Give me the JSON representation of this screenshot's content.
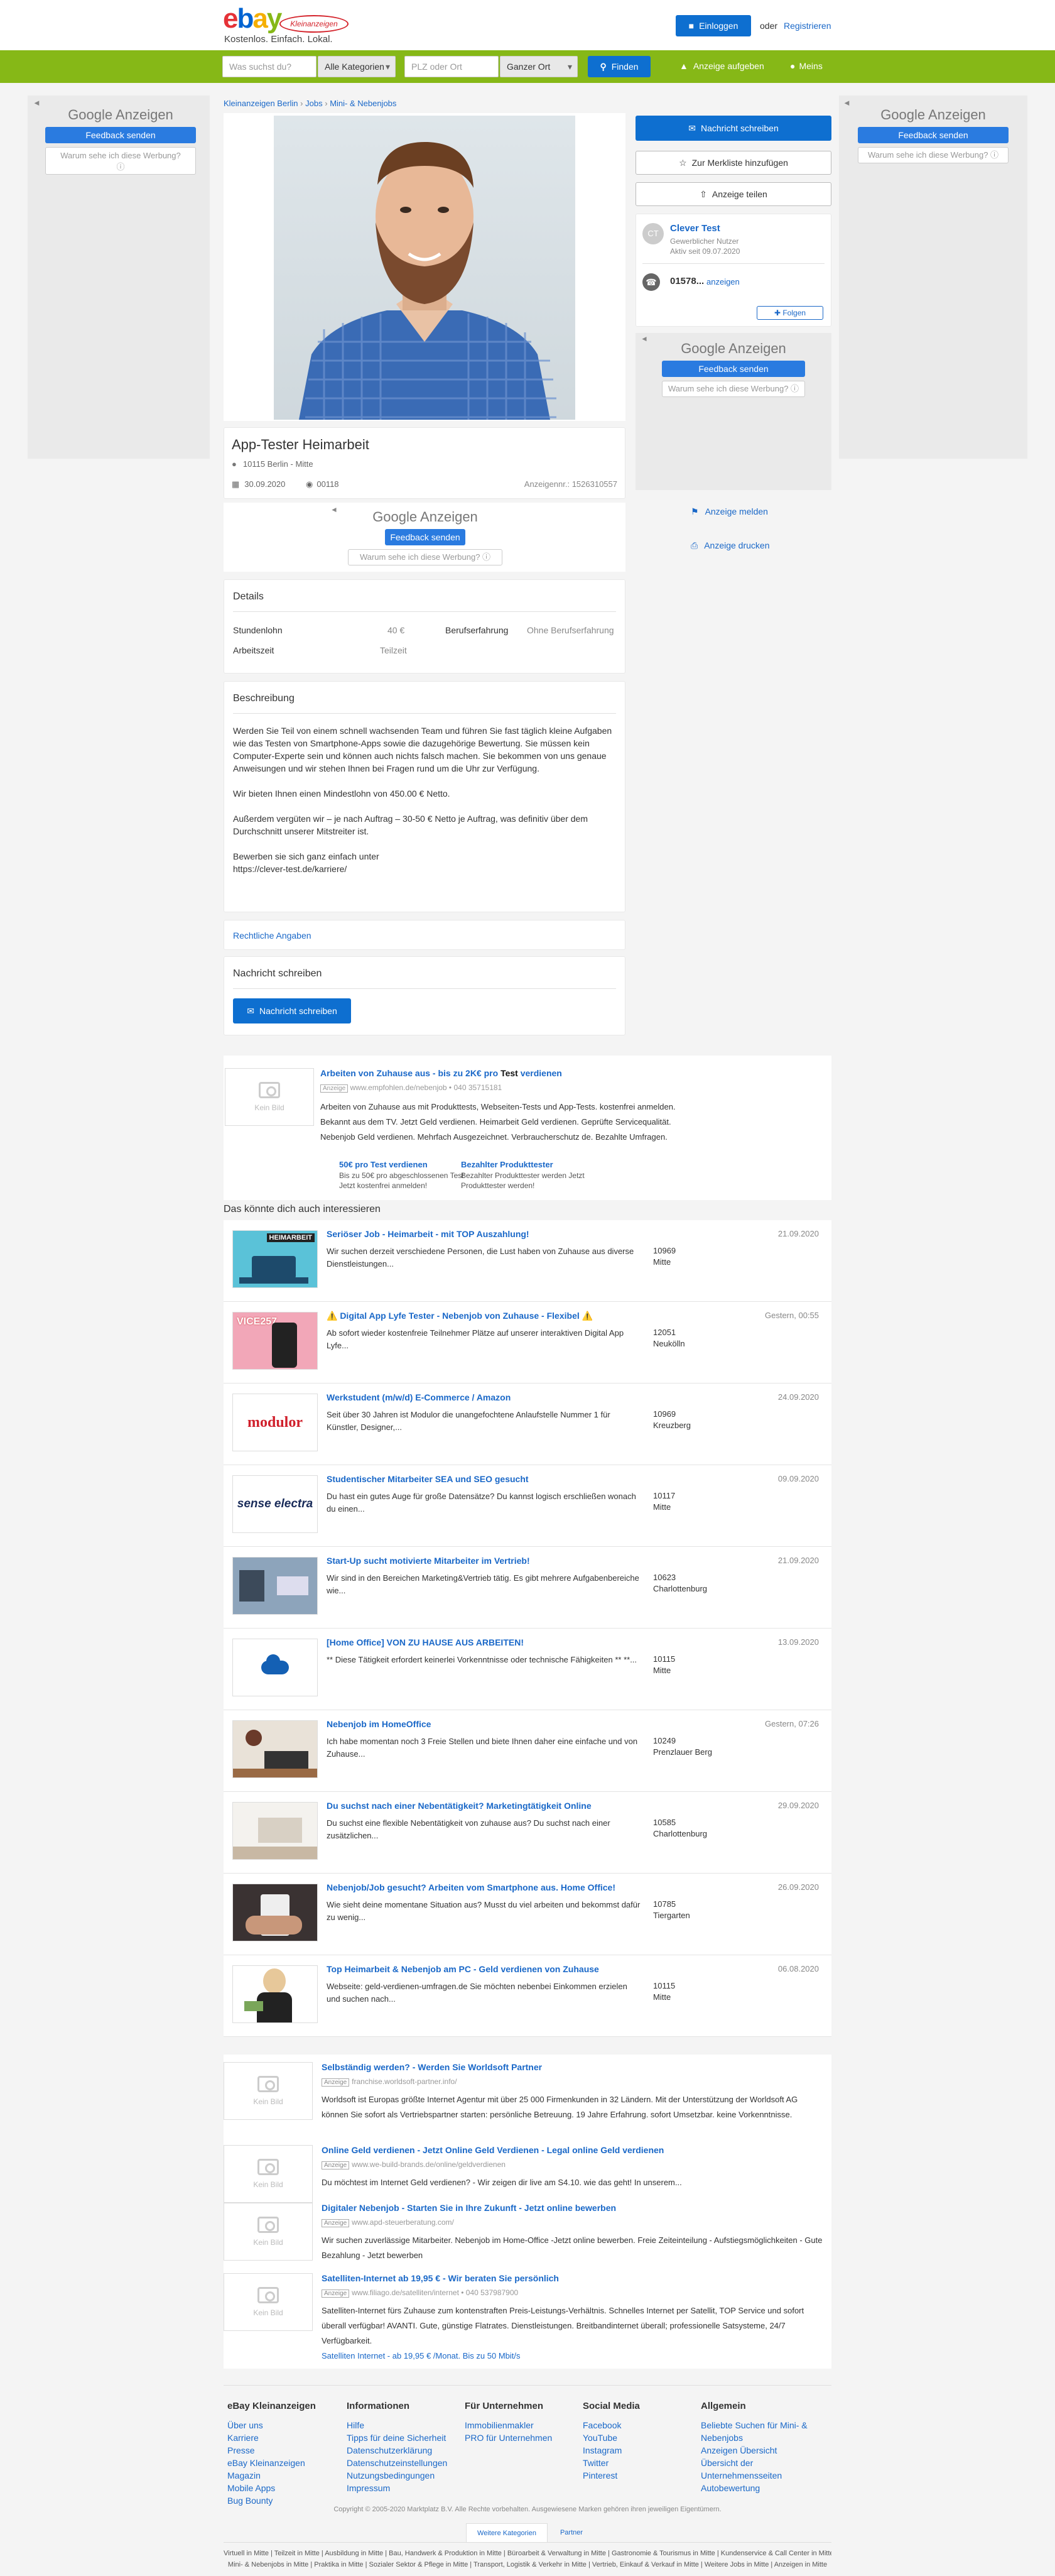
{
  "header": {
    "logo_main": "ebay",
    "logo_badge": "Kleinanzeigen",
    "tagline": "Kostenlos. Einfach. Lokal.",
    "login": "Einloggen",
    "or": "oder",
    "register": "Registrieren"
  },
  "search": {
    "what_placeholder": "Was suchst du?",
    "category": "Alle Kategorien",
    "where_placeholder": "PLZ oder Ort",
    "radius": "Ganzer Ort",
    "find": "Finden",
    "post_ad": "Anzeige aufgeben",
    "mine": "Meins"
  },
  "gads": {
    "google": "Google",
    "anzeigen": "Anzeigen",
    "feedback": "Feedback senden",
    "why": "Warum sehe ich diese Werbung?"
  },
  "breadcrumb": [
    "Kleinanzeigen Berlin",
    "Jobs",
    "Mini- & Nebenjobs"
  ],
  "ad": {
    "title": "App-Tester Heimarbeit",
    "location": "10115 Berlin - Mitte",
    "date": "30.09.2020",
    "views": "00118",
    "ad_no_label": "Anzeigennr.:",
    "ad_no": "1526310557"
  },
  "side": {
    "message": "Nachricht schreiben",
    "watchlist": "Zur Merkliste hinzufügen",
    "share": "Anzeige teilen",
    "avatar": "CT",
    "seller": "Clever Test",
    "seller_type": "Gewerblicher Nutzer",
    "active_since": "Aktiv seit 09.07.2020",
    "phone": "01578...",
    "phone_show": "anzeigen",
    "follow": "Folgen",
    "report": "Anzeige melden",
    "print": "Anzeige drucken"
  },
  "details": {
    "heading": "Details",
    "rows": [
      {
        "k": "Stundenlohn",
        "v": "40 €",
        "k2": "Berufserfahrung",
        "v2": "Ohne Berufserfahrung"
      },
      {
        "k": "Arbeitszeit",
        "v": "Teilzeit",
        "k2": "",
        "v2": ""
      }
    ]
  },
  "description": {
    "heading": "Beschreibung",
    "paragraphs": [
      "Werden Sie Teil von einem schnell wachsenden Team und führen Sie fast täglich kleine Aufgaben wie das Testen von Smartphone-Apps sowie die dazugehörige Bewertung. Sie müssen kein Computer-Experte sein und können auch nichts falsch machen. Sie bekommen von uns genaue Anweisungen und wir stehen Ihnen bei Fragen rund um die Uhr zur Verfügung.",
      "Wir bieten Ihnen einen Mindestlohn von 450.00 € Netto.",
      "Außerdem vergüten wir – je nach Auftrag – 30-50 € Netto je Auftrag, was definitiv über dem Durchschnitt unserer Mitstreiter ist.",
      "Bewerben sie sich ganz einfach unter\nhttps://clever-test.de/karriere/"
    ]
  },
  "legal": "Rechtliche Angaben",
  "contact": {
    "heading": "Nachricht schreiben",
    "button": "Nachricht schreiben"
  },
  "top_ad": {
    "title_pre": "Arbeiten von Zuhause aus - bis zu 2K€ pro ",
    "title_bold": "Test",
    "title_post": " verdienen",
    "badge": "Anzeige",
    "url": "www.empfohlen.de/nebenjob",
    "phone": "040 35715181",
    "desc1": "Arbeiten von Zuhause aus mit Produkttests, Webseiten-Tests und App-Tests. kostenfrei anmelden.",
    "desc2": "Bekannt aus dem TV. Jetzt Geld verdienen. Heimarbeit Geld verdienen. Geprüfte Servicequalität.",
    "desc3": "Nebenjob Geld verdienen. Mehrfach Ausgezeichnet. Verbraucherschutz de. Bezahlte Umfragen.",
    "sub": [
      {
        "t": "50€ pro Test verdienen",
        "d": "Bis zu 50€ pro abgeschlossenen Test Jetzt kostenfrei anmelden!"
      },
      {
        "t": "Bezahlter Produkttester",
        "d": "Bezahlter Produkttester werden Jetzt Produkttester werden!"
      }
    ],
    "no_image": "Kein Bild"
  },
  "related_heading": "Das könnte dich auch interessieren",
  "related": [
    {
      "title": "Seriöser Job - Heimarbeit - mit TOP Auszahlung!",
      "desc": "Wir suchen derzeit verschiedene Personen, die Lust haben von Zuhause aus diverse Dienstleistungen...",
      "plz": "10969",
      "area": "Mitte",
      "date": "21.09.2020",
      "thumb": "heimarbeit"
    },
    {
      "title": "⚠️ Digital App Lyfe Tester - Nebenjob von Zuhause - Flexibel ⚠️",
      "desc": "Ab sofort wieder kostenfreie Teilnehmer Plätze auf unserer interaktiven Digital App Lyfe...",
      "plz": "12051",
      "area": "Neukölln",
      "date": "Gestern, 00:55",
      "thumb": "phone"
    },
    {
      "title": "Werkstudent (m/w/d) E-Commerce / Amazon",
      "desc": "Seit über 30 Jahren ist Modulor die unangefochtene Anlaufstelle Nummer 1 für Künstler, Designer,...",
      "plz": "10969",
      "area": "Kreuzberg",
      "date": "24.09.2020",
      "thumb": "modulor"
    },
    {
      "title": "Studentischer Mitarbeiter SEA und SEO gesucht",
      "desc": "Du hast ein gutes Auge für große Datensätze? Du kannst logisch erschließen wonach du einen...",
      "plz": "10117",
      "area": "Mitte",
      "date": "09.09.2020",
      "thumb": "sense"
    },
    {
      "title": "Start-Up sucht motivierte Mitarbeiter im Vertrieb!",
      "desc": "Wir sind in den Bereichen Marketing&Vertrieb tätig. Es gibt mehrere Aufgabenbereiche wie...",
      "plz": "10623",
      "area": "Charlottenburg",
      "date": "21.09.2020",
      "thumb": "office"
    },
    {
      "title": "[Home Office] VON ZU HAUSE AUS ARBEITEN!",
      "desc": "** Diese Tätigkeit erfordert keinerlei Vorkenntnisse oder technische Fähigkeiten ** **...",
      "plz": "10115",
      "area": "Mitte",
      "date": "13.09.2020",
      "thumb": "cloud"
    },
    {
      "title": "Nebenjob im HomeOffice",
      "desc": "Ich habe momentan noch 3 Freie Stellen und biete Ihnen daher eine einfache und von Zuhause...",
      "plz": "10249",
      "area": "Prenzlauer Berg",
      "date": "Gestern, 07:26",
      "thumb": "laptop"
    },
    {
      "title": "Du suchst nach einer Nebentätigkeit? Marketingtätigkeit Online",
      "desc": "Du suchst eine flexible Nebentätigkeit von zuhause aus? Du suchst nach einer zusätzlichen...",
      "plz": "10585",
      "area": "Charlottenburg",
      "date": "29.09.2020",
      "thumb": "desk"
    },
    {
      "title": "Nebenjob/Job gesucht? Arbeiten vom Smartphone aus. Home Office!",
      "desc": "Wie sieht deine momentane Situation aus? Musst du viel arbeiten und bekommst dafür zu wenig...",
      "plz": "10785",
      "area": "Tiergarten",
      "date": "26.09.2020",
      "thumb": "phonehand"
    },
    {
      "title": "Top Heimarbeit & Nebenjob am PC - Geld verdienen von Zuhause",
      "desc": "Webseite: geld-verdienen-umfragen.de Sie möchten nebenbei Einkommen erzielen und suchen nach...",
      "plz": "10115",
      "area": "Mitte",
      "date": "06.08.2020",
      "thumb": "woman"
    }
  ],
  "bottom_ads": [
    {
      "title": "Selbständig werden? - Werden Sie Worldsoft Partner",
      "url": "franchise.worldsoft-partner.info/",
      "desc": "Worldsoft ist Europas größte Internet Agentur mit über 25 000 Firmenkunden in 32 Ländern. Mit der Unterstützung der Worldsoft AG können Sie sofort als Vertriebspartner starten: persönliche Betreuung. 19 Jahre Erfahrung. sofort Umsetzbar. keine Vorkenntnisse."
    },
    {
      "title": "Online Geld verdienen - Jetzt Online Geld Verdienen - Legal online Geld verdienen",
      "url": "www.we-build-brands.de/online/geldverdienen",
      "desc": "Du möchtest im Internet Geld verdienen? - Wir zeigen dir live am S4.10. wie das geht! In unserem..."
    },
    {
      "title": "Digitaler Nebenjob - Starten Sie in Ihre Zukunft - Jetzt online bewerben",
      "url": "www.apd-steuerberatung.com/",
      "desc": "Wir suchen zuverlässige Mitarbeiter. Nebenjob im Home-Office -Jetzt online bewerben. Freie Zeiteinteilung - Aufstiegsmöglichkeiten - Gute Bezahlung - Jetzt bewerben"
    },
    {
      "title": "Satelliten-Internet ab 19,95 € - Wir beraten Sie persönlich",
      "url": "www.filiago.de/satelliten/internet",
      "phone": "040 537987900",
      "desc": "Satelliten-Internet fürs Zuhause zum kontenstraften Preis-Leistungs-Verhältnis. Schnelles Internet per Satellit, TOP Service und sofort überall verfügbar! AVANTI. Gute, günstige Flatrates. Dienstleistungen. Breitbandinternet überall; professionelle Satsysteme, 24/7 Verfügbarkeit.",
      "extra": "Satelliten Internet - ab 19,95 € /Monat. Bis zu 50 Mbit/s"
    }
  ],
  "no_image": "Kein Bild",
  "footer": {
    "cols": [
      {
        "h": "eBay Kleinanzeigen",
        "items": [
          "Über uns",
          "Karriere",
          "Presse",
          "eBay Kleinanzeigen Magazin",
          "Mobile Apps",
          "Bug Bounty"
        ]
      },
      {
        "h": "Informationen",
        "items": [
          "Hilfe",
          "Tipps für deine Sicherheit",
          "Datenschutzerklärung",
          "Datenschutzeinstellungen",
          "Nutzungsbedingungen",
          "Impressum"
        ]
      },
      {
        "h": "Für Unternehmen",
        "items": [
          "Immobilienmakler",
          "PRO für Unternehmen"
        ]
      },
      {
        "h": "Social Media",
        "items": [
          "Facebook",
          "YouTube",
          "Instagram",
          "Twitter",
          "Pinterest"
        ]
      },
      {
        "h": "Allgemein",
        "items": [
          "Beliebte Suchen für Mini- & Nebenjobs",
          "Anzeigen Übersicht",
          "Übersicht der Unternehmensseiten",
          "Autobewertung"
        ]
      }
    ],
    "copyright": "Copyright © 2005-2020 Marktplatz B.V. Alle Rechte vorbehalten. Ausgewiesene Marken gehören ihren jeweiligen Eigentümern.",
    "tab1": "Weitere Kategorien",
    "tab2": "Partner",
    "links1": "Virtuell in Mitte | Teilzeit in Mitte | Ausbildung in Mitte | Bau, Handwerk & Produktion in Mitte | Büroarbeit & Verwaltung in Mitte | Gastronomie & Tourismus in Mitte | Kundenservice & Call Center in Mitte",
    "links2": "Mini- & Nebenjobs in Mitte | Praktika in Mitte | Sozialer Sektor & Pflege in Mitte | Transport, Logistik & Verkehr in Mitte | Vertrieb, Einkauf & Verkauf in Mitte | Weitere Jobs in Mitte | Anzeigen in Mitte"
  }
}
